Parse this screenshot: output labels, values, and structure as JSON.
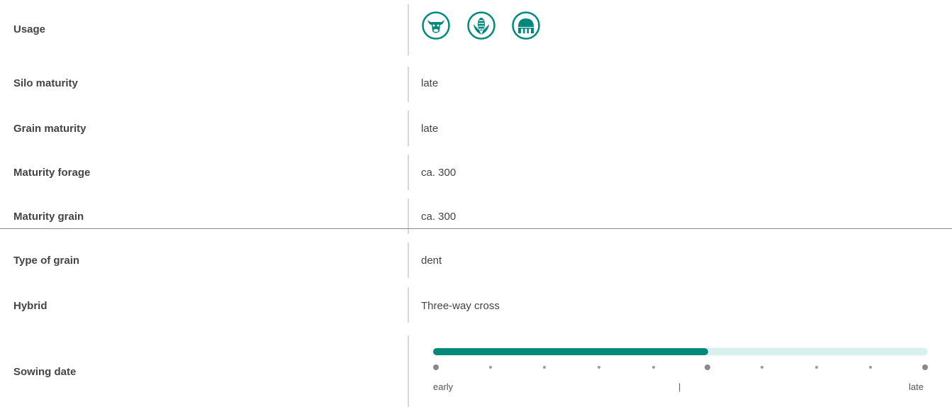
{
  "colors": {
    "accent": "#00897b",
    "track": "#d8f1ee",
    "divider": "#d8d8d8"
  },
  "rows": [
    {
      "label": "Usage"
    },
    {
      "label": "Silo maturity",
      "value": "late"
    },
    {
      "label": "Grain maturity",
      "value": "late"
    },
    {
      "label": "Maturity forage",
      "value": "ca. 300"
    },
    {
      "label": "Maturity grain",
      "value": "ca. 300"
    },
    {
      "label": "Type of grain",
      "value": "dent"
    },
    {
      "label": "Hybrid",
      "value": "Three-way cross"
    },
    {
      "label": "Sowing date"
    }
  ],
  "usage_icons": [
    "cow-icon",
    "corn-icon",
    "biogas-icon"
  ],
  "sowing_scale": {
    "min_label": "early",
    "mid_label": "|",
    "max_label": "late",
    "steps": 10,
    "level": 0.556
  }
}
